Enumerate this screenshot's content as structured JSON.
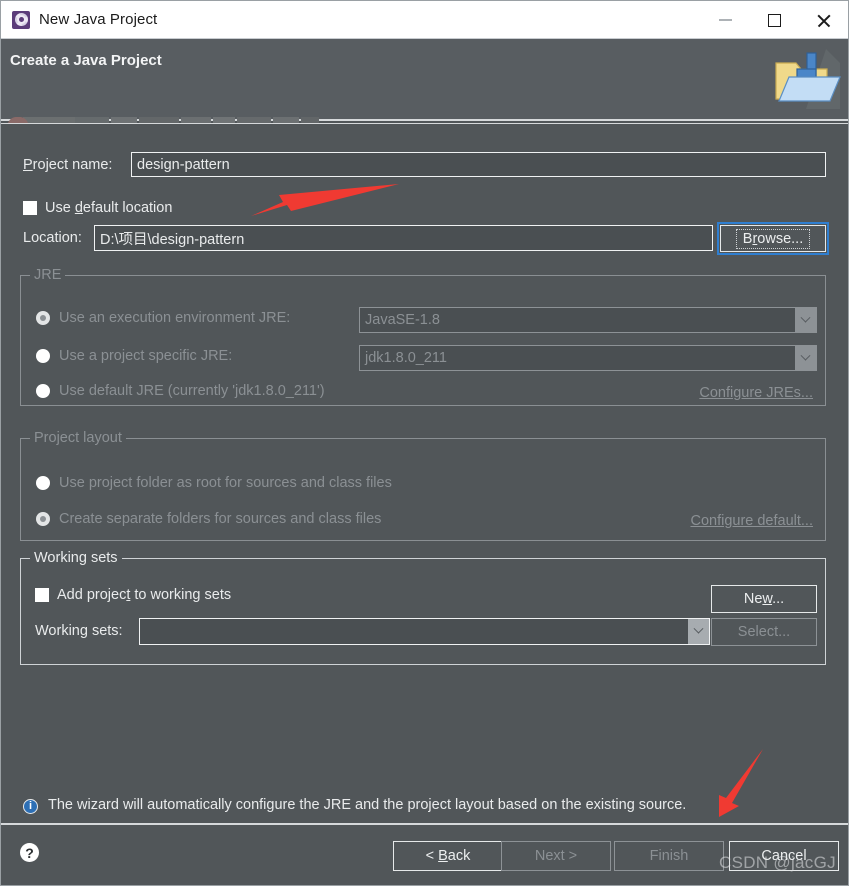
{
  "window": {
    "title": "New Java Project",
    "app_icon": "eclipse-icon",
    "controls": {
      "minimize": "minimize-icon",
      "maximize": "maximize-icon",
      "close": "close-icon"
    }
  },
  "banner": {
    "title": "Create a Java Project",
    "subtitle_blurred": "",
    "icon": "java-project-folder-icon"
  },
  "form": {
    "project_name": {
      "label": "Project name:",
      "mnemonic": "P",
      "value": "design-pattern"
    },
    "use_default_location": {
      "label": "Use default location",
      "mnemonic": "d",
      "checked": false
    },
    "location": {
      "label": "Location:",
      "value": "D:\\项目\\design-pattern"
    },
    "browse_button": {
      "label": "Browse...",
      "mnemonic": "r",
      "focused": true,
      "enabled": true
    }
  },
  "jre_group": {
    "title": "JRE",
    "enabled": false,
    "options": [
      {
        "label": "Use an execution environment JRE:",
        "selected": true,
        "combo_value": "JavaSE-1.8"
      },
      {
        "label": "Use a project specific JRE:",
        "selected": false,
        "combo_value": "jdk1.8.0_211"
      },
      {
        "label": "Use default JRE (currently 'jdk1.8.0_211')",
        "selected": false,
        "combo_value": ""
      }
    ],
    "configure_link": "Configure JREs..."
  },
  "project_layout_group": {
    "title": "Project layout",
    "enabled": false,
    "options": [
      {
        "label": "Use project folder as root for sources and class files",
        "selected": false
      },
      {
        "label": "Create separate folders for sources and class files",
        "selected": true
      }
    ],
    "configure_link": "Configure default..."
  },
  "working_sets_group": {
    "title": "Working sets",
    "add_checkbox": {
      "label": "Add project to working sets",
      "mnemonic": "t",
      "checked": false
    },
    "combo_label": "Working sets:",
    "combo_value": "",
    "new_button": {
      "label": "New...",
      "mnemonic": "w",
      "enabled": true
    },
    "select_button": {
      "label": "Select...",
      "enabled": false
    }
  },
  "info": {
    "icon": "info-icon",
    "message": "The wizard will automatically configure the JRE and the project layout based on the existing source."
  },
  "footer": {
    "help_icon": "help-icon",
    "buttons": [
      {
        "label": "< Back",
        "mnemonic": "B",
        "enabled": true
      },
      {
        "label": "Next >",
        "enabled": false
      },
      {
        "label": "Finish",
        "enabled": false
      },
      {
        "label": "Cancel",
        "enabled": true
      }
    ]
  },
  "annotations": {
    "arrow_color": "#f03a32",
    "arrow_1_target": "use-default-location-checkbox",
    "arrow_2_target": "finish-button",
    "watermark": "CSDN @jacGJ"
  },
  "colors": {
    "dialog_bg": "#515659",
    "banner_bg": "#585d61",
    "titlebar_bg": "#ffffff",
    "field_bg": "#4a4f52",
    "text": "#e9ebec",
    "disabled_text": "#8b9094",
    "focus_ring": "#2f7fd1",
    "info_blue": "#2d6fb5",
    "accent_red": "#f03a32"
  }
}
